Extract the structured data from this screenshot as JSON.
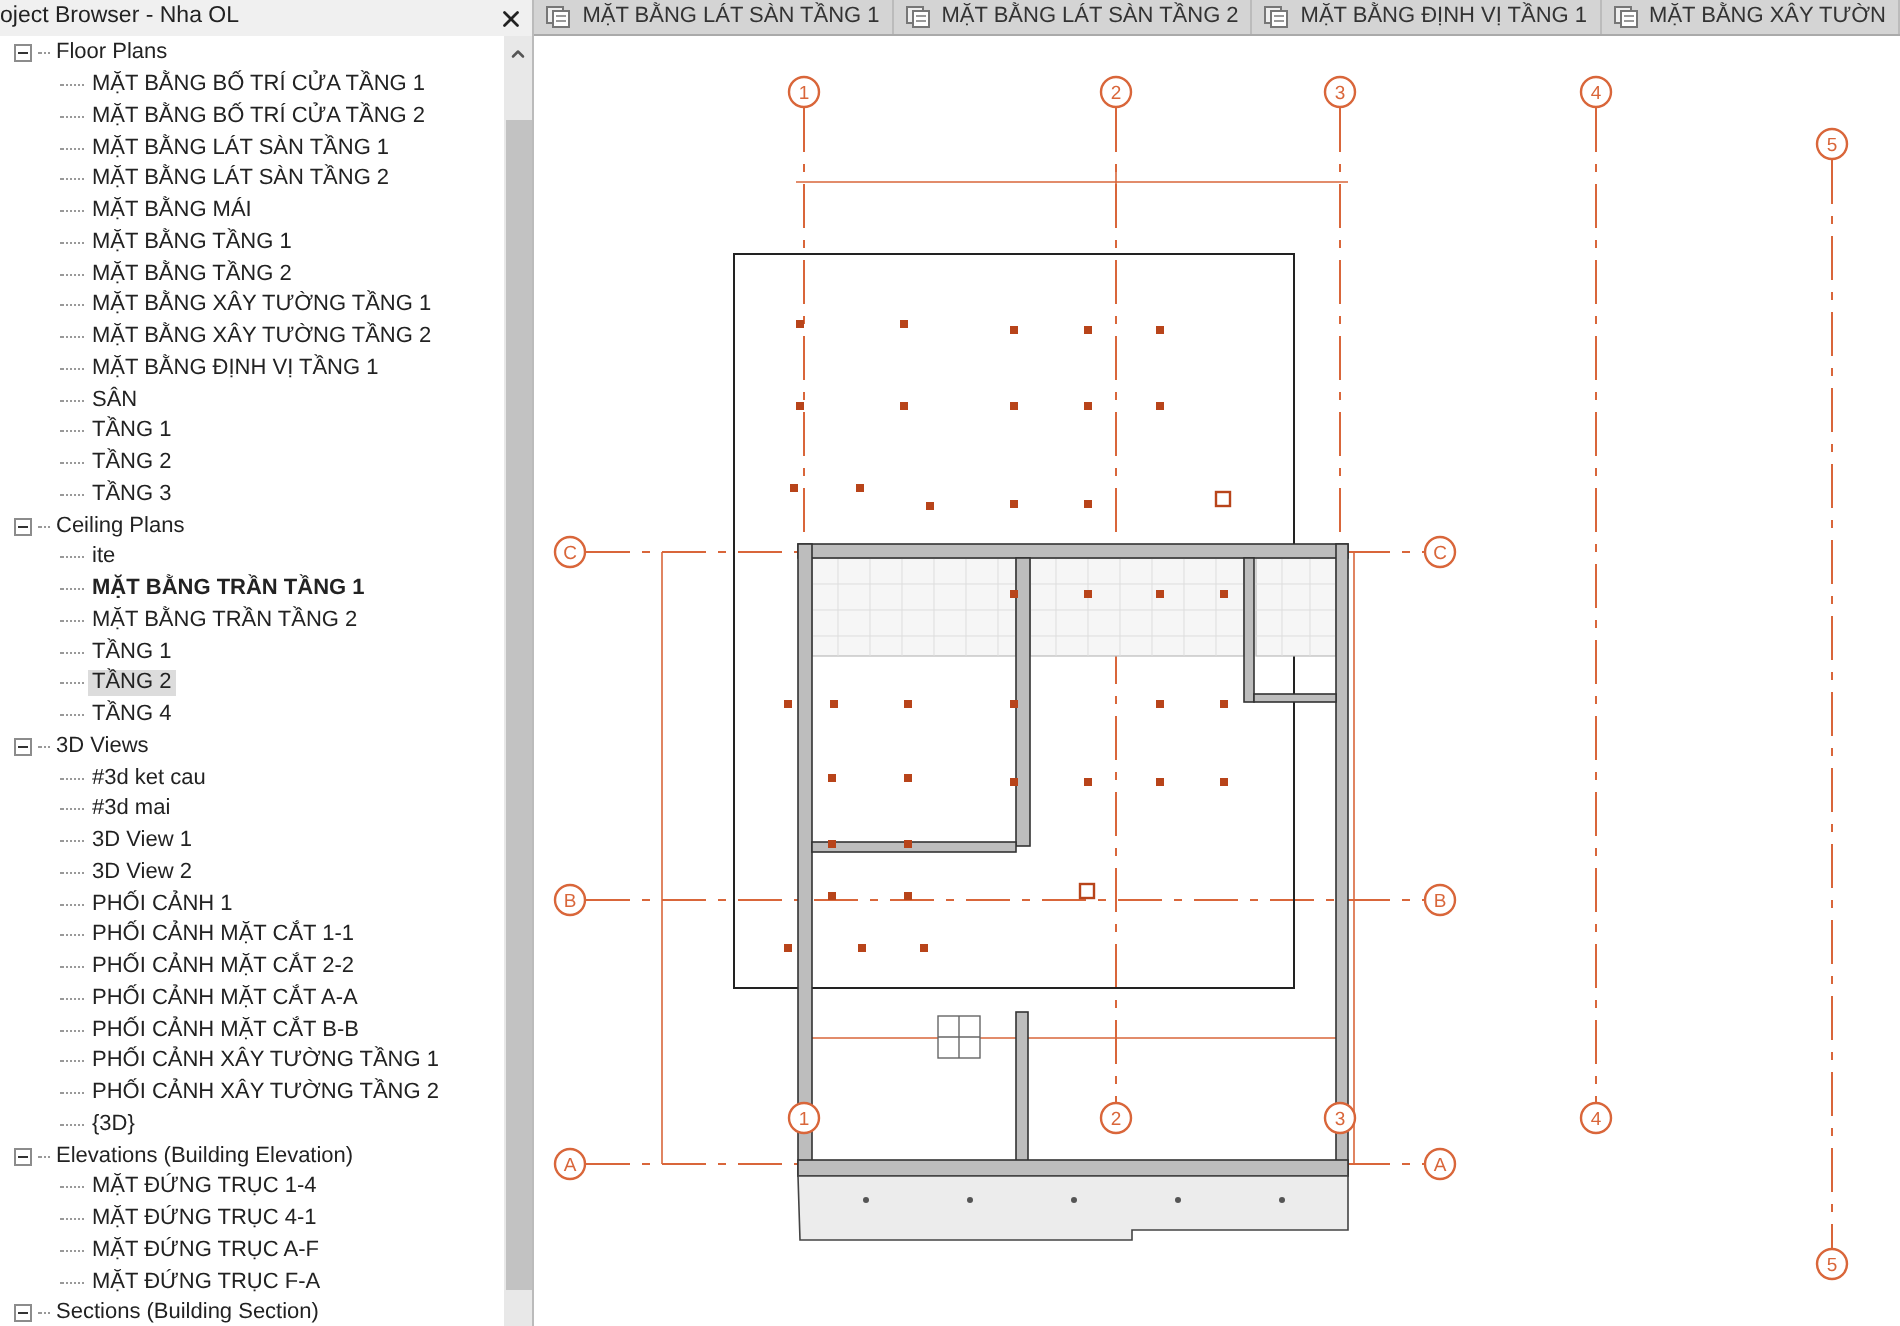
{
  "browser": {
    "title": "oject Browser - Nha OL",
    "groups": [
      {
        "label": "Floor Plans",
        "expanded": true,
        "items": [
          {
            "label": "MẶT BẰNG BỐ TRÍ CỬA TẦNG 1",
            "selected": false,
            "current": false
          },
          {
            "label": "MẶT BẰNG BỐ TRÍ CỬA TẦNG 2",
            "selected": false,
            "current": false
          },
          {
            "label": "MẶT BẰNG LÁT SÀN TẦNG 1",
            "selected": false,
            "current": false
          },
          {
            "label": "MẶT BẰNG LÁT SÀN TẦNG 2",
            "selected": false,
            "current": false
          },
          {
            "label": "MẶT BẰNG MÁI",
            "selected": false,
            "current": false
          },
          {
            "label": "MẶT BẰNG TẦNG 1",
            "selected": false,
            "current": false
          },
          {
            "label": "MẶT BẰNG TẦNG 2",
            "selected": false,
            "current": false
          },
          {
            "label": "MẶT BẰNG XÂY TƯỜNG TẦNG 1",
            "selected": false,
            "current": false
          },
          {
            "label": "MẶT BẰNG XÂY TƯỜNG TẦNG 2",
            "selected": false,
            "current": false
          },
          {
            "label": "MẶT BẰNG ĐỊNH VỊ TẦNG 1",
            "selected": false,
            "current": false
          },
          {
            "label": "SÂN",
            "selected": false,
            "current": false
          },
          {
            "label": "TẦNG 1",
            "selected": false,
            "current": false
          },
          {
            "label": "TẦNG 2",
            "selected": false,
            "current": false
          },
          {
            "label": "TẦNG 3",
            "selected": false,
            "current": false
          }
        ]
      },
      {
        "label": "Ceiling Plans",
        "expanded": true,
        "items": [
          {
            "label": "ite",
            "selected": false,
            "current": false
          },
          {
            "label": "MẶT BẰNG TRẦN TẦNG 1",
            "selected": false,
            "current": true
          },
          {
            "label": "MẶT BẰNG TRẦN TẦNG 2",
            "selected": false,
            "current": false
          },
          {
            "label": "TẦNG 1",
            "selected": false,
            "current": false
          },
          {
            "label": "TẦNG 2",
            "selected": true,
            "current": false
          },
          {
            "label": "TẦNG 4",
            "selected": false,
            "current": false
          }
        ]
      },
      {
        "label": "3D Views",
        "expanded": true,
        "items": [
          {
            "label": "#3d ket cau",
            "selected": false,
            "current": false
          },
          {
            "label": "#3d mai",
            "selected": false,
            "current": false
          },
          {
            "label": "3D View 1",
            "selected": false,
            "current": false
          },
          {
            "label": "3D View 2",
            "selected": false,
            "current": false
          },
          {
            "label": "PHỐI CẢNH 1",
            "selected": false,
            "current": false
          },
          {
            "label": "PHỐI CẢNH MẶT CẮT 1-1",
            "selected": false,
            "current": false
          },
          {
            "label": "PHỐI CẢNH MẶT CẮT 2-2",
            "selected": false,
            "current": false
          },
          {
            "label": "PHỐI CẢNH MẶT CẮT A-A",
            "selected": false,
            "current": false
          },
          {
            "label": "PHỐI CẢNH MẶT CẮT B-B",
            "selected": false,
            "current": false
          },
          {
            "label": "PHỐI CẢNH XÂY TƯỜNG TẦNG 1",
            "selected": false,
            "current": false
          },
          {
            "label": "PHỐI CẢNH XÂY TƯỜNG TẦNG 2",
            "selected": false,
            "current": false
          },
          {
            "label": "{3D}",
            "selected": false,
            "current": false
          }
        ]
      },
      {
        "label": "Elevations (Building Elevation)",
        "expanded": true,
        "items": [
          {
            "label": "MẶT ĐỨNG TRỤC 1-4",
            "selected": false,
            "current": false
          },
          {
            "label": "MẶT ĐỨNG TRỤC 4-1",
            "selected": false,
            "current": false
          },
          {
            "label": "MẶT ĐỨNG TRỤC A-F",
            "selected": false,
            "current": false
          },
          {
            "label": "MẶT ĐỨNG TRỤC F-A",
            "selected": false,
            "current": false
          }
        ]
      },
      {
        "label": "Sections (Building Section)",
        "expanded": true
      }
    ]
  },
  "tabs": [
    {
      "label": "MẶT BẰNG LÁT SÀN TẦNG 1",
      "selected": false
    },
    {
      "label": "MẶT BẰNG LÁT SÀN TẦNG 2",
      "selected": false
    },
    {
      "label": "MẶT BẰNG ĐỊNH VỊ TẦNG 1",
      "selected": false
    },
    {
      "label": "MẶT BẰNG XÂY TƯỜN",
      "selected": false
    }
  ],
  "drawing": {
    "grid_columns": [
      {
        "label": "1"
      },
      {
        "label": "2"
      },
      {
        "label": "3"
      },
      {
        "label": "4"
      },
      {
        "label": "5"
      }
    ],
    "grid_rows": [
      {
        "left": "C",
        "right": "C"
      },
      {
        "left": "B",
        "right": "B"
      },
      {
        "left": "A",
        "right": "A"
      }
    ],
    "bottom_bubbles": [
      {
        "label": "1"
      },
      {
        "label": "2"
      },
      {
        "label": "3"
      },
      {
        "label": "4"
      },
      {
        "label": "5"
      }
    ]
  }
}
